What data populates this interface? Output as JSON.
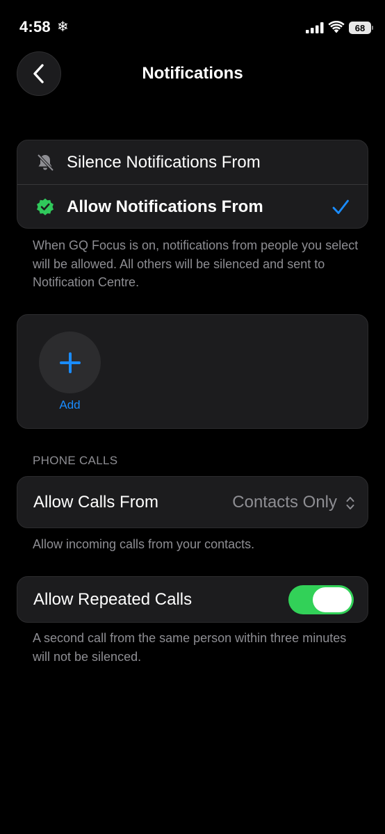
{
  "status_bar": {
    "time": "4:58",
    "focus_icon": "snowflake-icon",
    "battery_level": "68"
  },
  "header": {
    "title": "Notifications",
    "back_icon": "chevron-left-icon"
  },
  "notification_mode": {
    "options": [
      {
        "label": "Silence Notifications From",
        "icon": "bell-slash-icon",
        "selected": false
      },
      {
        "label": "Allow Notifications From",
        "icon": "checkmark-seal-icon",
        "selected": true
      }
    ],
    "description": "When GQ Focus is on, notifications from people you select will be allowed. All others will be silenced and sent to Notification Centre."
  },
  "people": {
    "add_label": "Add"
  },
  "phone_calls": {
    "section_title": "PHONE CALLS",
    "allow_calls_label": "Allow Calls From",
    "allow_calls_value": "Contacts Only",
    "allow_calls_description": "Allow incoming calls from your contacts.",
    "repeated_calls_label": "Allow Repeated Calls",
    "repeated_calls_enabled": true,
    "repeated_calls_description": "A second call from the same person within three minutes will not be silenced."
  },
  "colors": {
    "accent_blue": "#1a8cff",
    "toggle_green": "#32d158",
    "seal_green": "#30c85b",
    "background": "#000000",
    "card": "#1c1c1e",
    "secondary_text": "#8e8e93"
  }
}
